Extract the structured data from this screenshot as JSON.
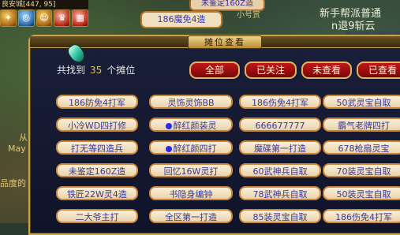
{
  "hud": {
    "top_text": "良安城[447, 95]",
    "icons": [
      "gold-pouch-icon",
      "compass-icon",
      "character-icon",
      "trophy-icon",
      "calendar-icon"
    ]
  },
  "world": {
    "float_top_label": "未鉴定160Z造",
    "float_stall_label": "186魔免4造",
    "npc_text_1": "新手帮派普通",
    "npc_text_2": "n退9斩云",
    "npc_text_3": "小号赏",
    "left_text_1": "从",
    "left_text_2": "May",
    "left_text_3": "品度的"
  },
  "dialog": {
    "title": "摊位查看",
    "found_prefix": "共找到",
    "found_count": "35",
    "found_suffix": "个摊位",
    "filters": [
      "全部",
      "已关注",
      "未查看",
      "已查看"
    ],
    "stalls": [
      [
        "186防免4打军",
        "灵饰灵饰BB",
        "186伤免4打军",
        "50武灵宝自取"
      ],
      [
        "小冷WD四打修",
        "●醉红颜装灵",
        "666677777",
        "霸气老牌四打"
      ],
      [
        "打无等四造兵",
        "●醉红颜四打",
        "魔碟第一打造",
        "678枪扇灵宝"
      ],
      [
        "未鉴定160Z造",
        "回忆16W灵打",
        "60武神兵自取",
        "70装灵宝自取"
      ],
      [
        "铁匠22W灵4造",
        "书隐身编钟",
        "78武神兵自取",
        "50装灵宝自取"
      ],
      [
        "二大爷主打",
        "全区第一打造",
        "85装灵宝自取",
        "186伤免4打军"
      ]
    ]
  }
}
